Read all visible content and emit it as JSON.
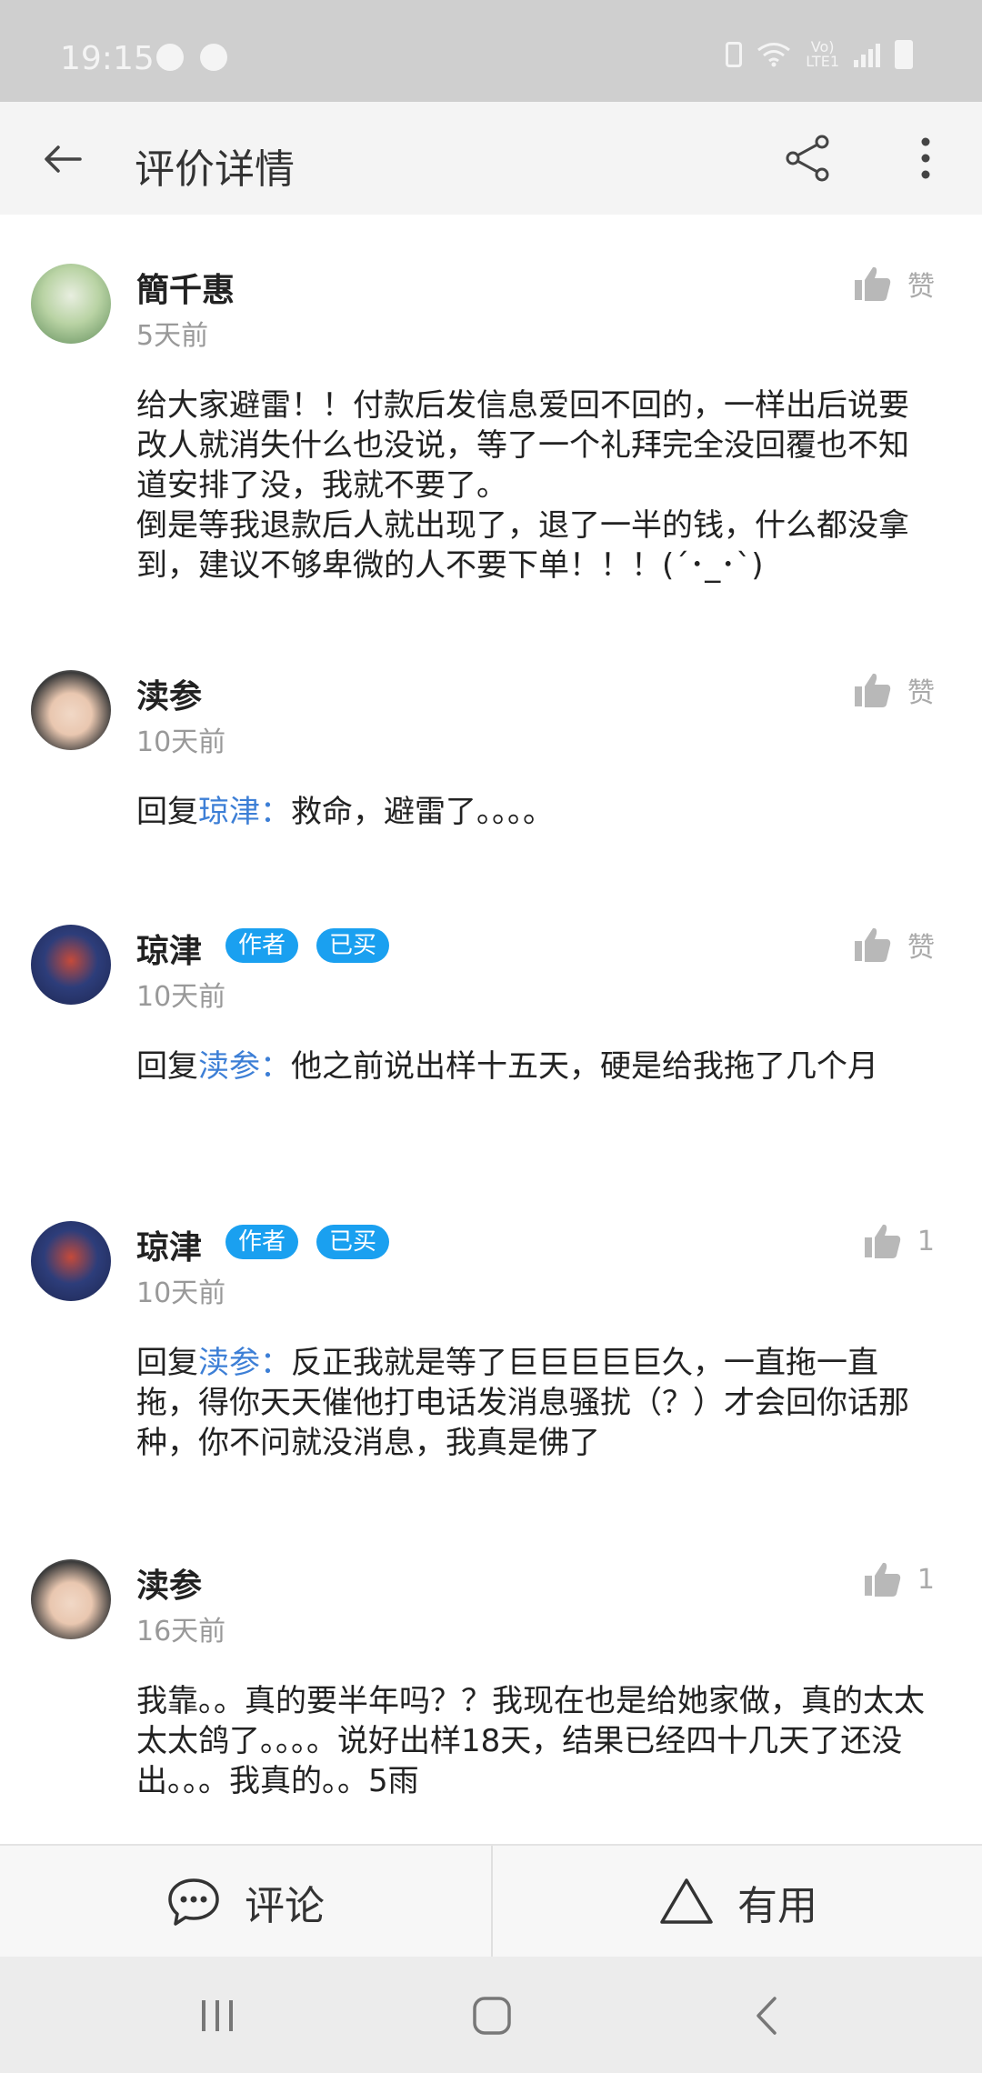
{
  "status_bar": {
    "time": "19:15",
    "network_label": "Vo)\nLTE1"
  },
  "app_bar": {
    "title": "评价详情"
  },
  "comments": [
    {
      "name": "簡千惠",
      "time": "5天前",
      "badges": [],
      "like_label": "赞",
      "body": "给大家避雷！！付款后发信息爱回不回的，一样出后说要改人就消失什么也没说，等了一个礼拜完全没回覆也不知道安排了没，我就不要了。\n倒是等我退款后人就出现了，退了一半的钱，什么都没拿到，建议不够卑微的人不要下单！！！(´･_･`)"
    },
    {
      "name": "渎参",
      "time": "10天前",
      "badges": [],
      "like_label": "赞",
      "reply_prefix": "回复",
      "reply_to": "琼津：",
      "body": "救命，避雷了。。。。"
    },
    {
      "name": "琼津",
      "time": "10天前",
      "badges": [
        "作者",
        "已买"
      ],
      "like_label": "赞",
      "reply_prefix": "回复",
      "reply_to": "渎参：",
      "body": "他之前说出样十五天，硬是给我拖了几个月"
    },
    {
      "name": "琼津",
      "time": "10天前",
      "badges": [
        "作者",
        "已买"
      ],
      "like_label": "1",
      "reply_prefix": "回复",
      "reply_to": "渎参：",
      "body": "反正我就是等了巨巨巨巨巨久，一直拖一直拖，得你天天催他打电话发消息骚扰（？）才会回你话那种，你不问就没消息，我真是佛了"
    },
    {
      "name": "渎参",
      "time": "16天前",
      "badges": [],
      "like_label": "1",
      "body": "我靠。。真的要半年吗？？我现在也是给她家做，真的太太太太鸽了。。。。说好出样18天，结果已经四十几天了还没出。。。我真的。。5雨"
    }
  ],
  "action_bar": {
    "comment_label": "评论",
    "useful_label": "有用"
  },
  "colors": {
    "accent": "#1aa0f0",
    "mention": "#3d7fd6"
  }
}
